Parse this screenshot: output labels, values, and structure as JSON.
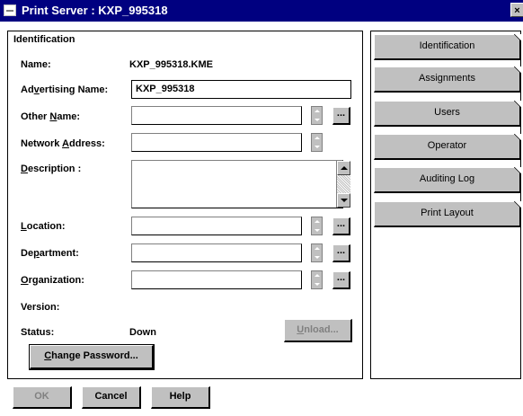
{
  "window": {
    "title": "Print Server : KXP_995318",
    "close_glyph": "×"
  },
  "identification": {
    "section_title": "Identification",
    "name_label": "Name:",
    "name_value": "KXP_995318.KME",
    "advertising_label": "Advertising Name:",
    "advertising_value": "KXP_995318",
    "other_name_label": "Other Name:",
    "other_name_value": "",
    "network_address_label": "Network Address:",
    "network_address_value": "",
    "description_label": "Description :",
    "description_value": "",
    "location_label": "Location:",
    "location_value": "",
    "department_label": "Department:",
    "department_value": "",
    "organization_label": "Organization:",
    "organization_value": "",
    "version_label": "Version:",
    "version_value": "",
    "status_label": "Status:",
    "status_value": "Down",
    "ellipsis": "...",
    "unload_button": "Unload...",
    "change_password_button": "Change Password..."
  },
  "tabs": [
    {
      "label": "Identification"
    },
    {
      "label": "Assignments"
    },
    {
      "label": "Users"
    },
    {
      "label": "Operator"
    },
    {
      "label": "Auditing Log"
    },
    {
      "label": "Print Layout"
    }
  ],
  "footer": {
    "ok_button": "OK",
    "cancel_button": "Cancel",
    "help_button": "Help"
  },
  "colors": {
    "titlebar": "#000080",
    "button_face": "#c0c0c0"
  }
}
